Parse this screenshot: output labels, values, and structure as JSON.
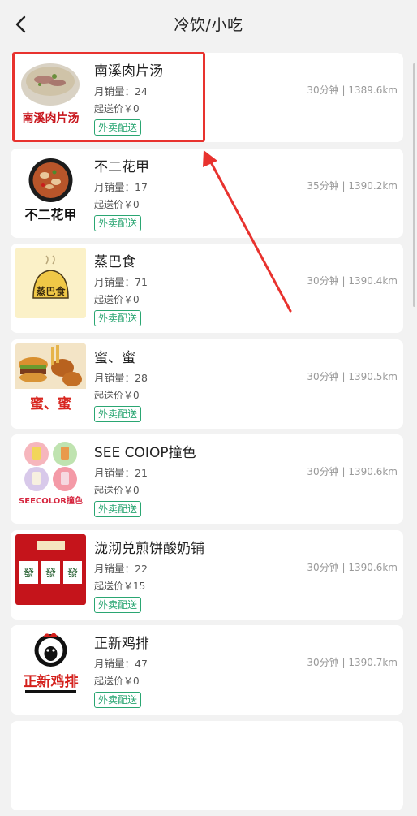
{
  "header": {
    "title": "冷饮/小吃"
  },
  "shops": [
    {
      "name": "南溪肉片汤",
      "sales": "月销量：24",
      "min_price": "起送价￥0",
      "tag": "外卖配送",
      "meta": "30分钟 | 1389.6km",
      "logo_text": "南溪肉片汤"
    },
    {
      "name": "不二花甲",
      "sales": "月销量：17",
      "min_price": "起送价￥0",
      "tag": "外卖配送",
      "meta": "35分钟 | 1390.2km",
      "logo_text": "不二花甲"
    },
    {
      "name": "蒸巴食",
      "sales": "月销量：71",
      "min_price": "起送价￥0",
      "tag": "外卖配送",
      "meta": "30分钟 | 1390.4km",
      "logo_text": "蒸巴食"
    },
    {
      "name": "蜜、蜜",
      "sales": "月销量：28",
      "min_price": "起送价￥0",
      "tag": "外卖配送",
      "meta": "30分钟 | 1390.5km",
      "logo_text": "蜜、蜜"
    },
    {
      "name": "SEE  COIOP撞色",
      "sales": "月销量：21",
      "min_price": "起送价￥0",
      "tag": "外卖配送",
      "meta": "30分钟 | 1390.6km",
      "logo_text": "SEECOLOR撞色"
    },
    {
      "name": "泷沏兑煎饼酸奶铺",
      "sales": "月销量：22",
      "min_price": "起送价￥15",
      "tag": "外卖配送",
      "meta": "30分钟 | 1390.6km",
      "logo_text": "發"
    },
    {
      "name": "正新鸡排",
      "sales": "月销量：47",
      "min_price": "起送价￥0",
      "tag": "外卖配送",
      "meta": "30分钟 | 1390.7km",
      "logo_text": "正新鸡排"
    }
  ],
  "colors": {
    "highlight": "#e8322e",
    "tag": "#2aa672"
  }
}
